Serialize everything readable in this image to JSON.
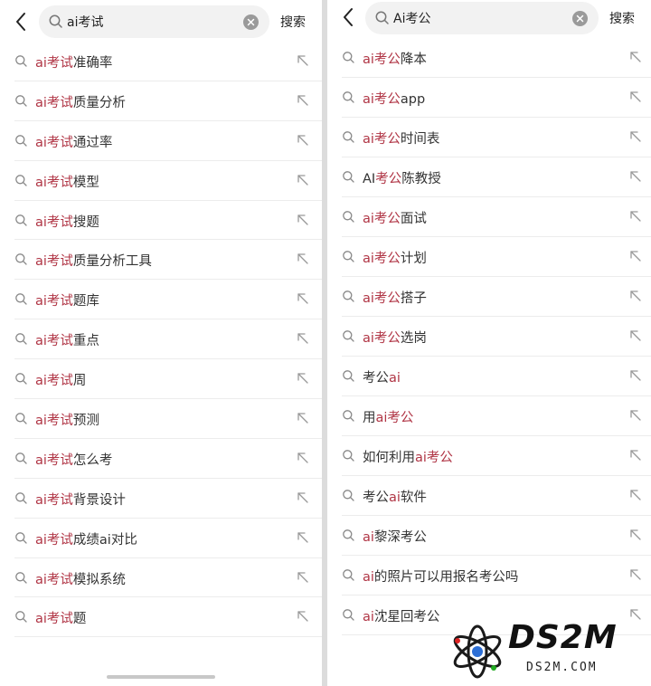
{
  "left": {
    "query": "ai考试",
    "search_label": "搜索",
    "highlight_color": "#b03545",
    "suggestions": [
      {
        "pre": "",
        "hl": "ai考试",
        "post": "准确率"
      },
      {
        "pre": "",
        "hl": "ai考试",
        "post": "质量分析"
      },
      {
        "pre": "",
        "hl": "ai考试",
        "post": "通过率"
      },
      {
        "pre": "",
        "hl": "ai考试",
        "post": "模型"
      },
      {
        "pre": "",
        "hl": "ai考试",
        "post": "搜题"
      },
      {
        "pre": "",
        "hl": "ai考试",
        "post": "质量分析工具"
      },
      {
        "pre": "",
        "hl": "ai考试",
        "post": "题库"
      },
      {
        "pre": "",
        "hl": "ai考试",
        "post": "重点"
      },
      {
        "pre": "",
        "hl": "ai考试",
        "post": "周"
      },
      {
        "pre": "",
        "hl": "ai考试",
        "post": "预测"
      },
      {
        "pre": "",
        "hl": "ai考试",
        "post": "怎么考"
      },
      {
        "pre": "",
        "hl": "ai考试",
        "post": "背景设计"
      },
      {
        "pre": "",
        "hl": "ai考试",
        "post": "成绩ai对比"
      },
      {
        "pre": "",
        "hl": "ai考试",
        "post": "模拟系统"
      },
      {
        "pre": "",
        "hl": "ai考试",
        "post": "题"
      }
    ]
  },
  "right": {
    "query": "Ai考公",
    "search_label": "搜索",
    "suggestions": [
      {
        "pre": "",
        "hl": "ai考公",
        "post": "降本"
      },
      {
        "pre": "",
        "hl": "ai考公",
        "post": "app"
      },
      {
        "pre": "",
        "hl": "ai考公",
        "post": "时间表"
      },
      {
        "pre": "AI",
        "hl": "考公",
        "post": "陈教授"
      },
      {
        "pre": "",
        "hl": "ai考公",
        "post": "面试"
      },
      {
        "pre": "",
        "hl": "ai考公",
        "post": "计划"
      },
      {
        "pre": "",
        "hl": "ai考公",
        "post": "搭子"
      },
      {
        "pre": "",
        "hl": "ai考公",
        "post": "选岗"
      },
      {
        "pre": "考公",
        "hl": "ai",
        "post": ""
      },
      {
        "pre": "用",
        "hl": "ai考公",
        "post": ""
      },
      {
        "pre": "如何利用",
        "hl": "ai考公",
        "post": ""
      },
      {
        "pre": "考公",
        "hl": "ai",
        "post": "软件"
      },
      {
        "pre": "",
        "hl": "ai",
        "post": "黎深考公"
      },
      {
        "pre": "",
        "hl": "ai",
        "post": "的照片可以用报名考公吗"
      },
      {
        "pre": "",
        "hl": "ai",
        "post": "沈星回考公"
      }
    ]
  },
  "watermark": {
    "main": "DS2M",
    "sub": "DS2M.COM"
  }
}
